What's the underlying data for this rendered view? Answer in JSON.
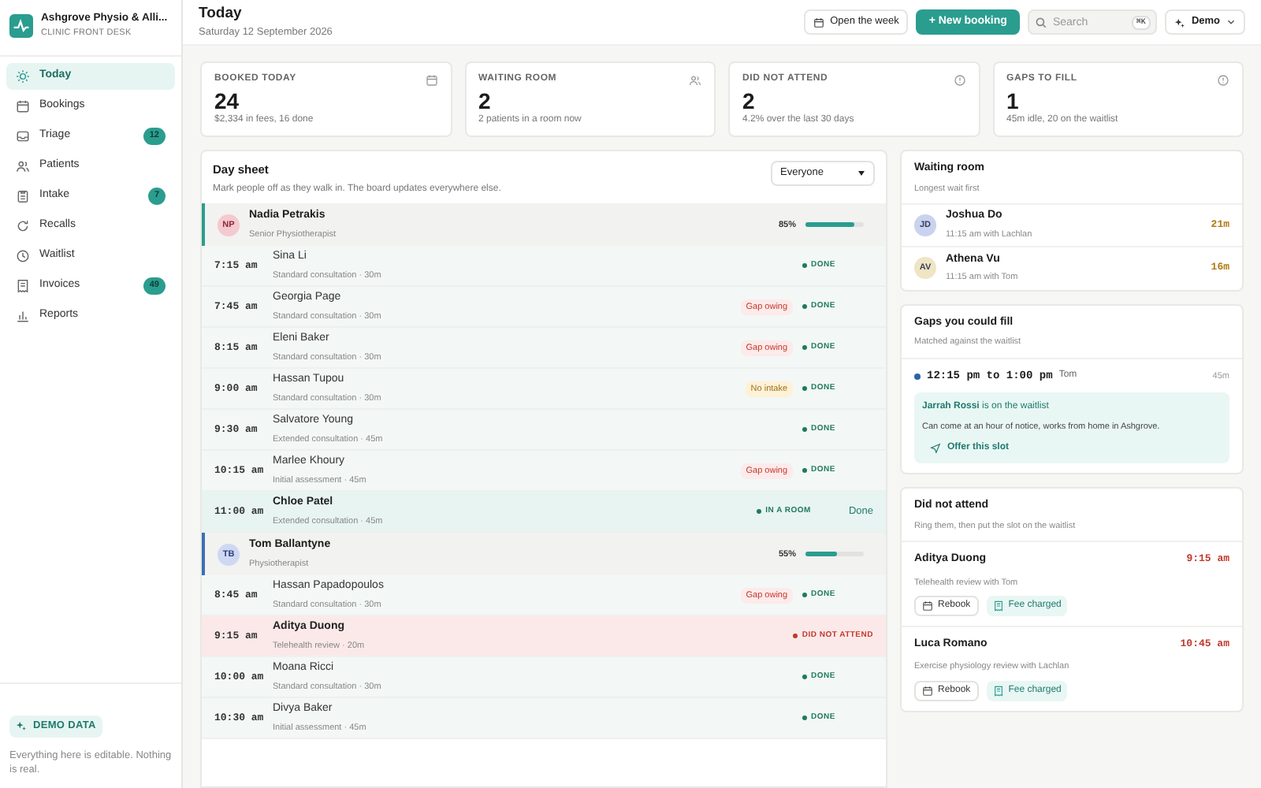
{
  "clinic": {
    "name": "Ashgrove Physio & Alli...",
    "subtitle": "CLINIC FRONT DESK"
  },
  "sidebar": {
    "items": [
      {
        "label": "Today",
        "selected": true
      },
      {
        "label": "Bookings",
        "selected": false
      },
      {
        "label": "Triage",
        "selected": false,
        "badge": "12"
      },
      {
        "label": "Patients",
        "selected": false
      },
      {
        "label": "Intake",
        "selected": false,
        "badge": "7"
      },
      {
        "label": "Recalls",
        "selected": false
      },
      {
        "label": "Waitlist",
        "selected": false
      },
      {
        "label": "Invoices",
        "selected": false,
        "badge": "49"
      },
      {
        "label": "Reports",
        "selected": false
      }
    ],
    "demo": {
      "badge": "DEMO DATA",
      "note": "Everything here is editable. Nothing is real."
    }
  },
  "header": {
    "title": "Today",
    "date": "Saturday 12 September 2026",
    "week_button": "Open the week",
    "new_button": "+ New booking",
    "search": {
      "placeholder": "Search",
      "shortcut": "⌘K"
    },
    "demo_menu": "Demo"
  },
  "stats": [
    {
      "label": "BOOKED TODAY",
      "value": "24",
      "note": "$2,334 in fees, 16 done"
    },
    {
      "label": "WAITING ROOM",
      "value": "2",
      "note": "2 patients in a room now"
    },
    {
      "label": "DID NOT ATTEND",
      "value": "2",
      "note": "4.2% over the last 30 days"
    },
    {
      "label": "GAPS TO FILL",
      "value": "1",
      "note": "45m idle, 20 on the waitlist"
    }
  ],
  "day_sheet": {
    "title": "Day sheet",
    "subtitle": "Mark people off as they walk in. The board updates everywhere else.",
    "filter": "Everyone",
    "rows": [
      {
        "kind": "practitioner",
        "initials": "NP",
        "name": "Nadia Petrakis",
        "role": "Senior Physiotherapist",
        "color": "#2a9d8f",
        "reading": "85%",
        "level": 0.85
      },
      {
        "kind": "done",
        "time": "7:15 am",
        "name": "Sina Li",
        "detail": "Standard consultation · 30m",
        "status_label": "DONE"
      },
      {
        "kind": "done",
        "time": "7:45 am",
        "name": "Georgia Page",
        "detail": "Standard consultation · 30m",
        "tag": {
          "label": "Gap owing",
          "kind": "owing"
        },
        "status_label": "DONE"
      },
      {
        "kind": "done",
        "time": "8:15 am",
        "name": "Eleni Baker",
        "detail": "Standard consultation · 30m",
        "tag": {
          "label": "Gap owing",
          "kind": "owing"
        },
        "status_label": "DONE"
      },
      {
        "kind": "done",
        "time": "9:00 am",
        "name": "Hassan Tupou",
        "detail": "Standard consultation · 30m",
        "tag": {
          "label": "No intake",
          "kind": "intake"
        },
        "status_label": "DONE"
      },
      {
        "kind": "done",
        "time": "9:30 am",
        "name": "Salvatore Young",
        "detail": "Extended consultation · 45m",
        "status_label": "DONE"
      },
      {
        "kind": "done",
        "time": "10:15 am",
        "name": "Marlee Khoury",
        "detail": "Initial assessment · 45m",
        "tag": {
          "label": "Gap owing",
          "kind": "owing"
        },
        "status_label": "DONE"
      },
      {
        "kind": "in_room",
        "time": "11:00 am",
        "name": "Chloe Patel",
        "detail": "Extended consultation · 45m",
        "status_label": "IN A ROOM",
        "action": "Done"
      },
      {
        "kind": "practitioner",
        "initials": "TB",
        "name": "Tom Ballantyne",
        "role": "Physiotherapist",
        "color": "#3b6fb6",
        "reading": "55%",
        "level": 0.55
      },
      {
        "kind": "done",
        "time": "8:45 am",
        "name": "Hassan Papadopoulos",
        "detail": "Standard consultation · 30m",
        "tag": {
          "label": "Gap owing",
          "kind": "owing"
        },
        "status_label": "DONE"
      },
      {
        "kind": "dna",
        "time": "9:15 am",
        "name": "Aditya Duong",
        "detail": "Telehealth review · 20m",
        "status_label": "DID NOT ATTEND"
      },
      {
        "kind": "done",
        "time": "10:00 am",
        "name": "Moana Ricci",
        "detail": "Standard consultation · 30m",
        "status_label": "DONE"
      },
      {
        "kind": "done",
        "time": "10:30 am",
        "name": "Divya Baker",
        "detail": "Initial assessment · 45m",
        "status_label": "DONE"
      }
    ]
  },
  "waiting_room": {
    "title": "Waiting room",
    "subtitle": "Longest wait first",
    "patients": [
      {
        "initials": "JD",
        "name": "Joshua Do",
        "detail": "11:15 am with Lachlan",
        "wait": "21m",
        "color": "#c9d3f0"
      },
      {
        "initials": "AV",
        "name": "Athena Vu",
        "detail": "11:15 am with Tom",
        "wait": "16m",
        "color": "#efe5c4"
      }
    ]
  },
  "gaps": {
    "title": "Gaps you could fill",
    "subtitle": "Matched against the waitlist",
    "slot": "12:15 pm to 1:00 pm",
    "practitioner": "Tom",
    "duration": "45m",
    "match": "**Jarrah Rossi** is on the waitlist",
    "match_note": "Can come at an hour of notice, works from home in Ashgrove.",
    "offer": "Offer this slot"
  },
  "did_not_attend": {
    "title": "Did not attend",
    "subtitle": "Ring them, then put the slot on the waitlist",
    "items": [
      {
        "name": "Aditya Duong",
        "time": "9:15 am",
        "detail": "Telehealth review with Tom",
        "rebook": "Rebook",
        "fee": "Fee charged"
      },
      {
        "name": "Luca Romano",
        "time": "10:45 am",
        "detail": "Exercise physiology review with Lachlan",
        "rebook": "Rebook",
        "fee": "Fee charged"
      }
    ]
  }
}
